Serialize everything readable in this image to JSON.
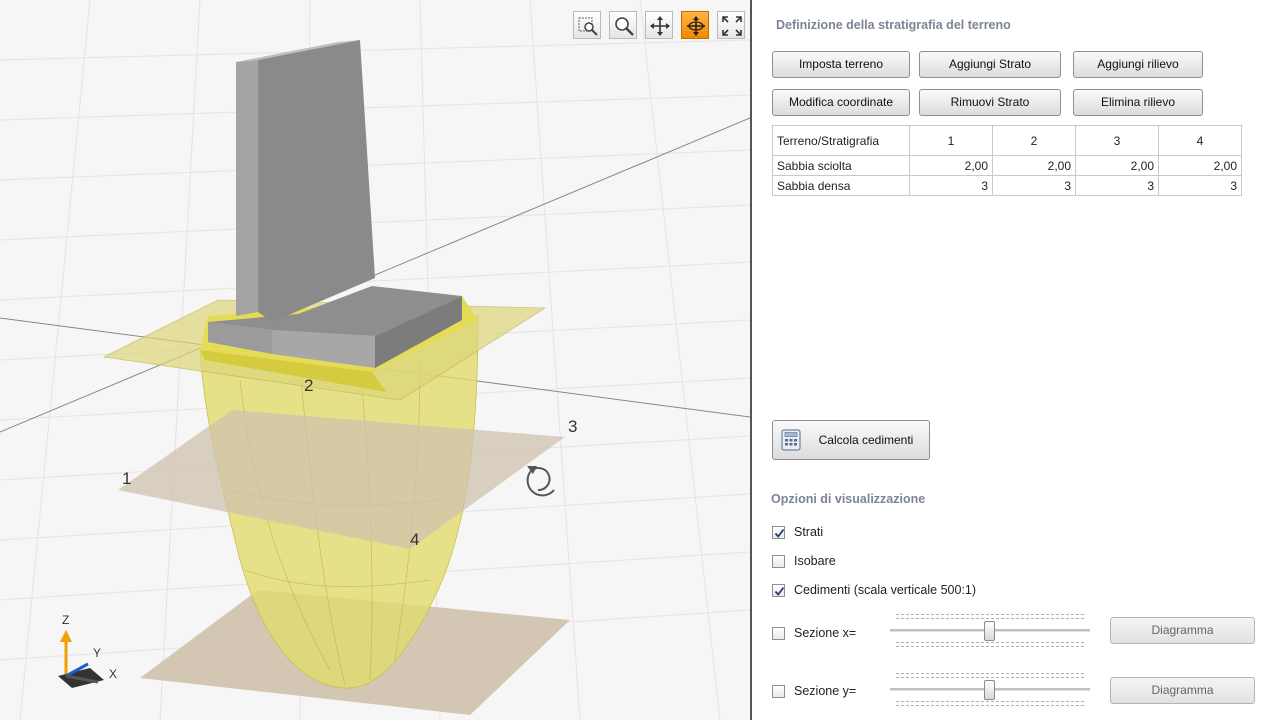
{
  "viewport": {
    "toolbar": [
      {
        "name": "zoom-window-icon",
        "active": false
      },
      {
        "name": "zoom-icon",
        "active": false
      },
      {
        "name": "pan-icon",
        "active": false
      },
      {
        "name": "rotate-icon",
        "active": true
      },
      {
        "name": "fit-view-icon",
        "active": false
      }
    ],
    "scene_labels": {
      "p1": "1",
      "p2": "2",
      "p3": "3",
      "p4": "4"
    },
    "axes": {
      "z": "Z",
      "y": "Y",
      "x": "X"
    },
    "colors": {
      "wall": "#8c8c8c",
      "bulb": "#e8e27a",
      "plane": "#cfc2ad",
      "slab": "#e0d75a"
    }
  },
  "panel": {
    "title": "Definizione della stratigrafia del terreno",
    "buttons": {
      "imposta_terreno": "Imposta terreno",
      "aggiungi_strato": "Aggiungi Strato",
      "aggiungi_rilievo": "Aggiungi rilievo",
      "modifica_coordinate": "Modifica coordinate",
      "rimuovi_strato": "Rimuovi Strato",
      "elimina_rilievo": "Elimina rilievo",
      "calcola_cedimenti": "Calcola cedimenti"
    },
    "table": {
      "header": [
        "Terreno/Stratigrafia",
        "1",
        "2",
        "3",
        "4"
      ],
      "rows": [
        {
          "name": "Sabbia sciolta",
          "values": [
            "2,00",
            "2,00",
            "2,00",
            "2,00"
          ]
        },
        {
          "name": "Sabbia densa",
          "values": [
            "3",
            "3",
            "3",
            "3"
          ]
        }
      ]
    },
    "options": {
      "title": "Opzioni di visualizzazione",
      "strati": {
        "label": "Strati",
        "checked": true
      },
      "isobare": {
        "label": "Isobare",
        "checked": false
      },
      "cedimenti": {
        "label": "Cedimenti (scala verticale 500:1)",
        "checked": true
      },
      "sezione_x": {
        "label": "Sezione x=",
        "checked": false,
        "button": "Diagramma",
        "slider_fraction": 0.5
      },
      "sezione_y": {
        "label": "Sezione y=",
        "checked": false,
        "button": "Diagramma",
        "slider_fraction": 0.5
      }
    }
  }
}
